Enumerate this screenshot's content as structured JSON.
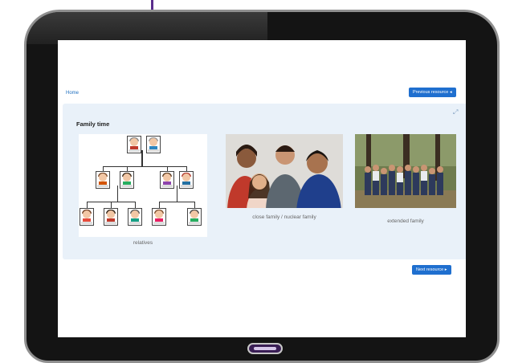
{
  "screen": {
    "home_link": "Home",
    "previous_button": "Previous resource ◂",
    "next_button": "Next resource ▸",
    "card": {
      "title": "Family time",
      "items": [
        {
          "caption": "relatives"
        },
        {
          "caption": "close family / nuclear family"
        },
        {
          "caption": "extended family"
        }
      ]
    }
  },
  "icons": {
    "expand": "expand-icon"
  },
  "colors": {
    "accent": "#1f6fcf",
    "card_background": "#e9f1f9",
    "bezel": "#141414",
    "brand_purple": "#5a2d8c"
  }
}
